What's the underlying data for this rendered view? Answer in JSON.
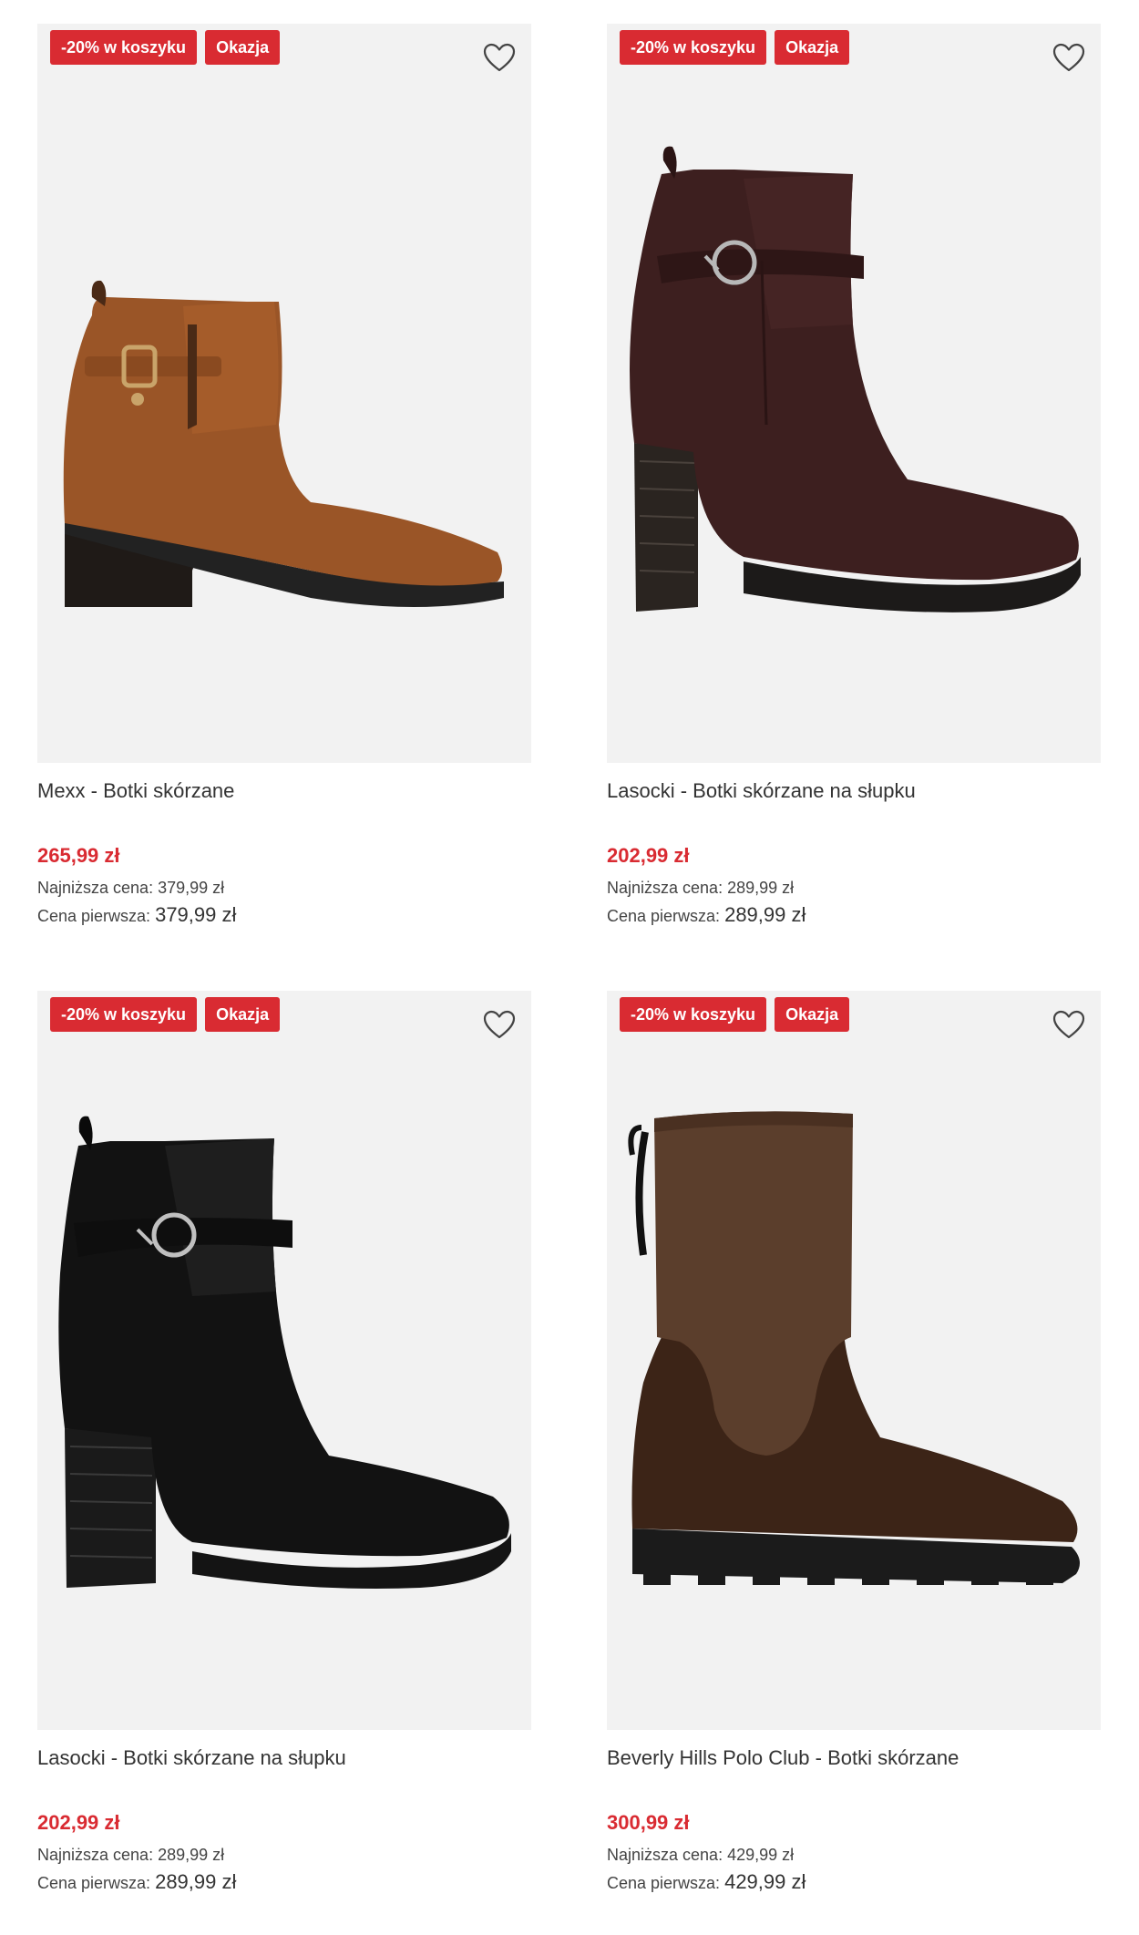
{
  "colors": {
    "badge_bg": "#d92b32",
    "price": "#d92b32",
    "image_bg": "#f2f2f2"
  },
  "products": [
    {
      "badge_discount": "-20% w koszyku",
      "badge_deal": "Okazja",
      "favorite_icon": "heart-icon",
      "title": "Mexx - Botki skórzane",
      "price": "265,99 zł",
      "lowest_label": "Najniższa cena:",
      "lowest_value": "379,99 zł",
      "first_label": "Cena pierwsza:",
      "first_value": "379,99 zł"
    },
    {
      "badge_discount": "-20% w koszyku",
      "badge_deal": "Okazja",
      "favorite_icon": "heart-icon",
      "title": "Lasocki - Botki skórzane na słupku",
      "price": "202,99 zł",
      "lowest_label": "Najniższa cena:",
      "lowest_value": "289,99 zł",
      "first_label": "Cena pierwsza:",
      "first_value": "289,99 zł"
    },
    {
      "badge_discount": "-20% w koszyku",
      "badge_deal": "Okazja",
      "favorite_icon": "heart-icon",
      "title": "Lasocki - Botki skórzane na słupku",
      "price": "202,99 zł",
      "lowest_label": "Najniższa cena:",
      "lowest_value": "289,99 zł",
      "first_label": "Cena pierwsza:",
      "first_value": "289,99 zł"
    },
    {
      "badge_discount": "-20% w koszyku",
      "badge_deal": "Okazja",
      "favorite_icon": "heart-icon",
      "title": "Beverly Hills Polo Club - Botki skórzane",
      "price": "300,99 zł",
      "lowest_label": "Najniższa cena:",
      "lowest_value": "429,99 zł",
      "first_label": "Cena pierwsza:",
      "first_value": "429,99 zł"
    }
  ]
}
